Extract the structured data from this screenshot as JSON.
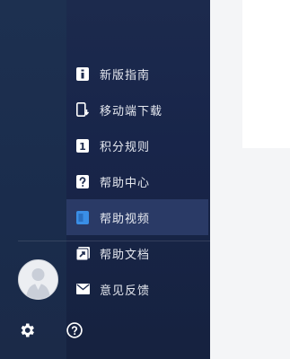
{
  "menu": {
    "items": [
      {
        "label": "新版指南",
        "icon": "guide-icon"
      },
      {
        "label": "移动端下载",
        "icon": "mobile-download-icon"
      },
      {
        "label": "积分规则",
        "icon": "points-rules-icon"
      },
      {
        "label": "帮助中心",
        "icon": "help-center-icon"
      },
      {
        "label": "帮助视频",
        "icon": "help-video-icon"
      },
      {
        "label": "帮助文档",
        "icon": "help-docs-icon"
      },
      {
        "label": "意见反馈",
        "icon": "feedback-icon"
      }
    ],
    "active_index": 4
  },
  "bottom": {
    "settings_icon": "gear-icon",
    "help_icon": "question-circle-icon",
    "avatar": "user-avatar"
  },
  "colors": {
    "sidebar_bg": "#1c2a4d",
    "active_item_bg": "#2a3a66",
    "text": "#e6e9f0",
    "active_icon": "#3a8ee6"
  }
}
